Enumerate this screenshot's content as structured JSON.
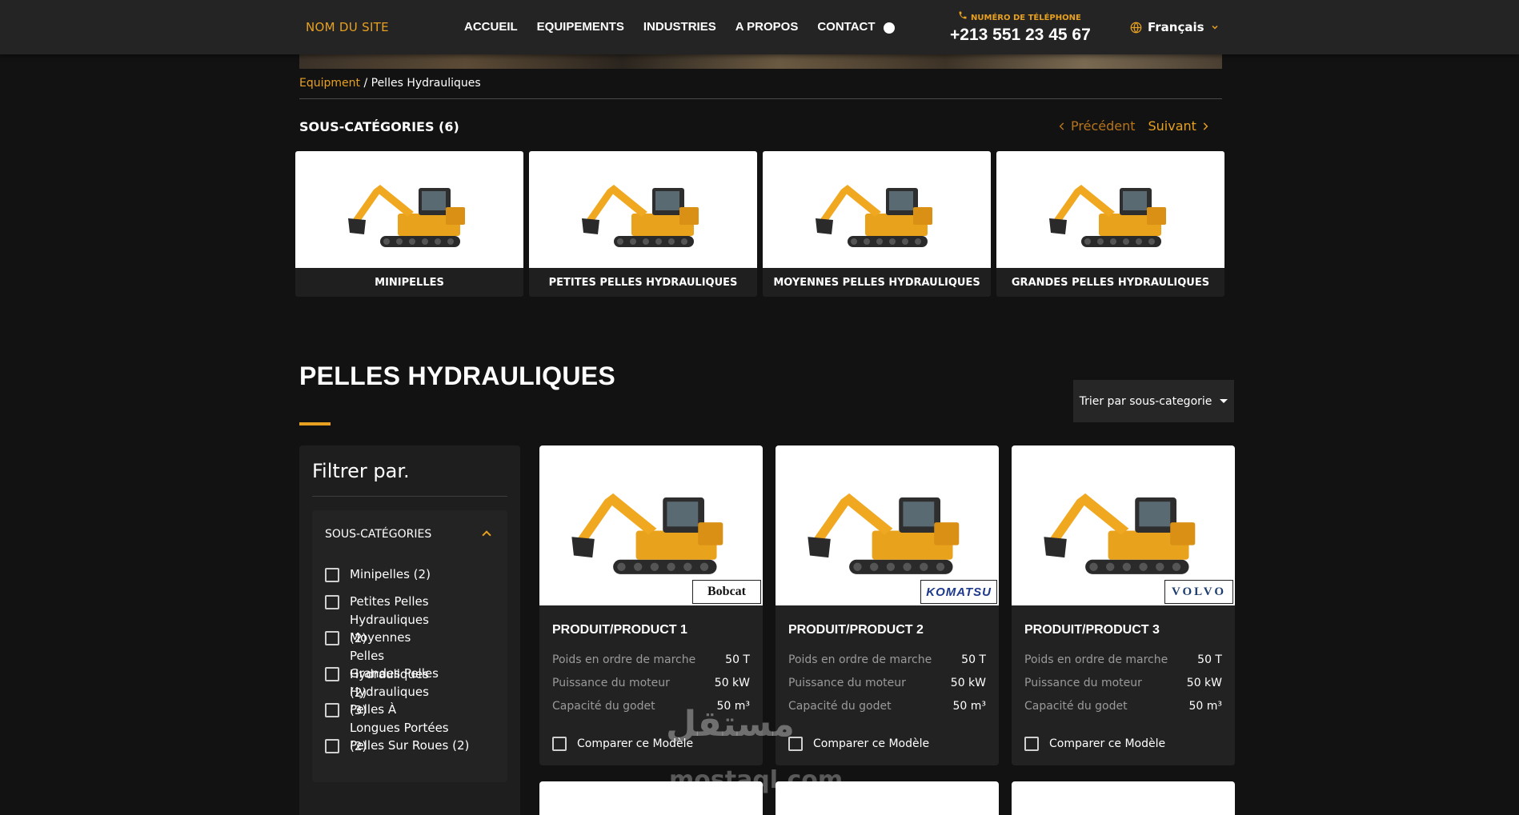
{
  "header": {
    "site_name": "NOM DU SITE",
    "nav": [
      "ACCUEIL",
      "EQUIPEMENTS",
      "INDUSTRIES",
      "A PROPOS",
      "CONTACT"
    ],
    "phone_label": "NUMÉRO DE TÉLÉPHONE",
    "phone_number": "+213 551 23 45 67",
    "language": "Français"
  },
  "breadcrumb": {
    "link": "Equipment",
    "separator": " / ",
    "current": "Pelles Hydrauliques"
  },
  "subcategories": {
    "title": "SOUS-CATÉGORIES (6)",
    "prev_label": "Précédent",
    "next_label": "Suivant",
    "items": [
      {
        "label": "MINIPELLES"
      },
      {
        "label": "PETITES PELLES HYDRAULIQUES"
      },
      {
        "label": "MOYENNES PELLES HYDRAULIQUES"
      },
      {
        "label": "GRANDES PELLES HYDRAULIQUES"
      }
    ]
  },
  "section": {
    "title": "PELLES HYDRAULIQUES",
    "sort_label": "Trier par sous-categorie"
  },
  "filter": {
    "title": "Filtrer par.",
    "group_label": "SOUS-CATÉGORIES",
    "options": [
      {
        "label": "Minipelles (2)"
      },
      {
        "label": "Petites Pelles Hydrauliques (2)"
      },
      {
        "label": "Moyennes Pelles Hydrauliques (2)"
      },
      {
        "label": "Grandes Pelles Hydrauliques (3)"
      },
      {
        "label": "Pelles À Longues Portées (2)"
      },
      {
        "label": "Pelles Sur Roues (2)"
      }
    ]
  },
  "products": [
    {
      "name": "PRODUIT/PRODUCT 1",
      "brand": "Bobcat",
      "specs": [
        {
          "k": "Poids en ordre de marche",
          "v": "50 T"
        },
        {
          "k": "Puissance du moteur",
          "v": "50 kW"
        },
        {
          "k": "Capacité du godet",
          "v": "50 m³"
        }
      ],
      "compare_label": "Comparer ce Modèle"
    },
    {
      "name": "PRODUIT/PRODUCT 2",
      "brand": "KOMATSU",
      "specs": [
        {
          "k": "Poids en ordre de marche",
          "v": "50 T"
        },
        {
          "k": "Puissance du moteur",
          "v": "50 kW"
        },
        {
          "k": "Capacité du godet",
          "v": "50 m³"
        }
      ],
      "compare_label": "Comparer ce Modèle"
    },
    {
      "name": "PRODUIT/PRODUCT 3",
      "brand": "VOLVO",
      "specs": [
        {
          "k": "Poids en ordre de marche",
          "v": "50 T"
        },
        {
          "k": "Puissance du moteur",
          "v": "50 kW"
        },
        {
          "k": "Capacité du godet",
          "v": "50 m³"
        }
      ],
      "compare_label": "Comparer ce Modèle"
    }
  ],
  "watermark": {
    "arabic": "مستقل",
    "latin": "mostaql.com"
  },
  "colors": {
    "accent": "#e8a020",
    "background": "#121212",
    "header": "#242424",
    "card": "#222222"
  }
}
